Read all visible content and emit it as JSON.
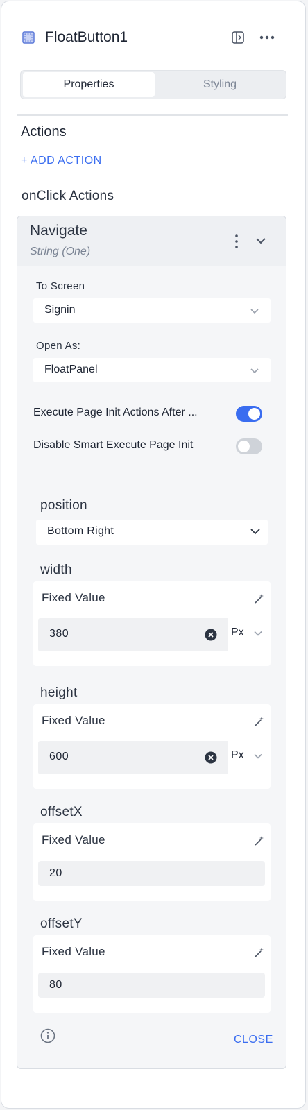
{
  "header": {
    "title": "FloatButton1",
    "icons": {
      "component": "float-button-component-icon",
      "split": "split-view-icon",
      "more": "more-horizontal-icon"
    }
  },
  "tabs": [
    {
      "label": "Properties",
      "active": true
    },
    {
      "label": "Styling",
      "active": false
    }
  ],
  "actions": {
    "section_title": "Actions",
    "add_action_label": "+ ADD ACTION",
    "onclick_title": "onClick Actions"
  },
  "action_card": {
    "title": "Navigate",
    "subtitle": "String (One)",
    "to_screen": {
      "label": "To Screen",
      "value": "Signin"
    },
    "open_as": {
      "label": "Open As:",
      "value": "FloatPanel"
    },
    "toggles": [
      {
        "label": "Execute Page Init Actions After ...",
        "on": true
      },
      {
        "label": "Disable Smart Execute Page Init",
        "on": false
      }
    ],
    "position": {
      "label": "position",
      "value": "Bottom Right"
    },
    "width": {
      "label": "width",
      "mode": "Fixed Value",
      "value": "380",
      "unit": "Px"
    },
    "height": {
      "label": "height",
      "mode": "Fixed Value",
      "value": "600",
      "unit": "Px"
    },
    "offsetX": {
      "label": "offsetX",
      "mode": "Fixed Value",
      "value": "20"
    },
    "offsetY": {
      "label": "offsetY",
      "mode": "Fixed Value",
      "value": "80"
    },
    "close_label": "CLOSE"
  },
  "colors": {
    "accent": "#3a6df0",
    "toggle_off": "#cfd3d9",
    "text": "#1e2533"
  }
}
